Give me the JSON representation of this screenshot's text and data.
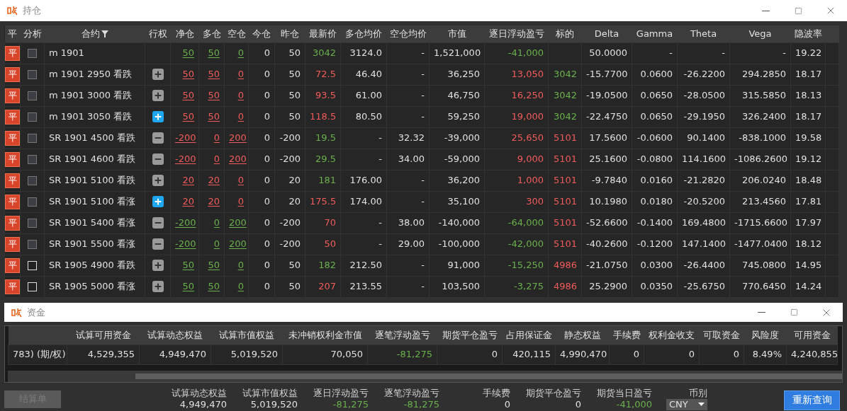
{
  "positions": {
    "title": "持仓",
    "columns": [
      "平",
      "分析",
      "合约",
      "行权",
      "净仓",
      "多仓",
      "空仓",
      "今仓",
      "昨仓",
      "最新价",
      "多仓均价",
      "空仓均价",
      "市值",
      "逐日浮动盈亏",
      "标的",
      "Delta",
      "Gamma",
      "Theta",
      "Vega",
      "隐波率"
    ],
    "rows": [
      {
        "close": "平",
        "checked": false,
        "disabled": true,
        "contract": "m 1901",
        "net": {
          "text": "50",
          "color": "#6ab04c"
        },
        "long": {
          "text": "50",
          "color": "#6ab04c"
        },
        "short": {
          "text": "0",
          "color": "#6ab04c"
        },
        "today": "0",
        "yesterday": "50",
        "last": {
          "text": "3042",
          "color": "#6ab04c"
        },
        "long_avg": "3124.0",
        "short_avg": "-",
        "market_value": "1,521,000",
        "pnl": {
          "text": "-41,000",
          "color": "#6ab04c"
        },
        "delta": "50.0000",
        "gamma": "-",
        "theta": "-",
        "vega": "-",
        "iv": "19.22"
      },
      {
        "close": "平",
        "checked": false,
        "disabled": true,
        "contract": "m 1901 2950 看跌",
        "exercise": {
          "kind": "plus",
          "selected": false
        },
        "net": {
          "text": "50",
          "color": "#f25b5b"
        },
        "long": {
          "text": "50",
          "color": "#f25b5b"
        },
        "short": {
          "text": "0",
          "color": "#f25b5b"
        },
        "today": "0",
        "yesterday": "50",
        "last": {
          "text": "72.5",
          "color": "#f25b5b"
        },
        "long_avg": "46.40",
        "short_avg": "-",
        "market_value": "36,250",
        "pnl": {
          "text": "13,050",
          "color": "#f25b5b"
        },
        "underlying": {
          "text": "3042",
          "color": "#6ab04c"
        },
        "delta": "-15.7700",
        "gamma": "0.0600",
        "theta": "-26.2200",
        "vega": "294.2850",
        "iv": "18.17"
      },
      {
        "close": "平",
        "checked": false,
        "disabled": true,
        "contract": "m 1901 3000 看跌",
        "exercise": {
          "kind": "plus",
          "selected": false
        },
        "net": {
          "text": "50",
          "color": "#f25b5b"
        },
        "long": {
          "text": "50",
          "color": "#f25b5b"
        },
        "short": {
          "text": "0",
          "color": "#f25b5b"
        },
        "today": "0",
        "yesterday": "50",
        "last": {
          "text": "93.5",
          "color": "#f25b5b"
        },
        "long_avg": "61.00",
        "short_avg": "-",
        "market_value": "46,750",
        "pnl": {
          "text": "16,250",
          "color": "#f25b5b"
        },
        "underlying": {
          "text": "3042",
          "color": "#6ab04c"
        },
        "delta": "-19.0500",
        "gamma": "0.0650",
        "theta": "-28.0500",
        "vega": "315.5850",
        "iv": "18.13"
      },
      {
        "close": "平",
        "checked": false,
        "disabled": true,
        "contract": "m 1901 3050 看跌",
        "exercise": {
          "kind": "plus",
          "selected": true
        },
        "net": {
          "text": "50",
          "color": "#f25b5b"
        },
        "long": {
          "text": "50",
          "color": "#f25b5b"
        },
        "short": {
          "text": "0",
          "color": "#f25b5b"
        },
        "today": "0",
        "yesterday": "50",
        "last": {
          "text": "118.5",
          "color": "#f25b5b"
        },
        "long_avg": "80.50",
        "short_avg": "-",
        "market_value": "59,250",
        "pnl": {
          "text": "19,000",
          "color": "#f25b5b"
        },
        "underlying": {
          "text": "3042",
          "color": "#6ab04c"
        },
        "delta": "-22.4750",
        "gamma": "0.0650",
        "theta": "-29.1950",
        "vega": "326.2400",
        "iv": "18.17"
      },
      {
        "close": "平",
        "checked": false,
        "disabled": true,
        "contract": "SR 1901 4500 看跌",
        "exercise": {
          "kind": "minus",
          "selected": false
        },
        "net": {
          "text": "-200",
          "color": "#f25b5b"
        },
        "long": {
          "text": "0",
          "color": "#f25b5b"
        },
        "short": {
          "text": "200",
          "color": "#f25b5b"
        },
        "today": "0",
        "yesterday": "-200",
        "last": {
          "text": "19.5",
          "color": "#6ab04c"
        },
        "long_avg": "-",
        "short_avg": "32.32",
        "market_value": "-39,000",
        "pnl": {
          "text": "25,650",
          "color": "#f25b5b"
        },
        "underlying": {
          "text": "5101",
          "color": "#f25b5b"
        },
        "delta": "17.5600",
        "gamma": "-0.0600",
        "theta": "90.1400",
        "vega": "-838.1000",
        "iv": "19.58"
      },
      {
        "close": "平",
        "checked": false,
        "disabled": true,
        "contract": "SR 1901 4600 看跌",
        "exercise": {
          "kind": "minus",
          "selected": false
        },
        "net": {
          "text": "-200",
          "color": "#f25b5b"
        },
        "long": {
          "text": "0",
          "color": "#f25b5b"
        },
        "short": {
          "text": "200",
          "color": "#f25b5b"
        },
        "today": "0",
        "yesterday": "-200",
        "last": {
          "text": "29.5",
          "color": "#6ab04c"
        },
        "long_avg": "-",
        "short_avg": "34.00",
        "market_value": "-59,000",
        "pnl": {
          "text": "9,000",
          "color": "#f25b5b"
        },
        "underlying": {
          "text": "5101",
          "color": "#f25b5b"
        },
        "delta": "25.1600",
        "gamma": "-0.0800",
        "theta": "114.1600",
        "vega": "-1086.2600",
        "iv": "19.12"
      },
      {
        "close": "平",
        "checked": false,
        "disabled": true,
        "contract": "SR 1901 5100 看跌",
        "exercise": {
          "kind": "plus",
          "selected": false
        },
        "net": {
          "text": "20",
          "color": "#f25b5b"
        },
        "long": {
          "text": "20",
          "color": "#f25b5b"
        },
        "short": {
          "text": "0",
          "color": "#f25b5b"
        },
        "today": "0",
        "yesterday": "20",
        "last": {
          "text": "181",
          "color": "#6ab04c"
        },
        "long_avg": "176.00",
        "short_avg": "-",
        "market_value": "36,200",
        "pnl": {
          "text": "1,000",
          "color": "#f25b5b"
        },
        "underlying": {
          "text": "5101",
          "color": "#f25b5b"
        },
        "delta": "-9.7840",
        "gamma": "0.0160",
        "theta": "-21.2820",
        "vega": "206.0240",
        "iv": "18.48"
      },
      {
        "close": "平",
        "checked": false,
        "disabled": true,
        "contract": "SR 1901 5100 看涨",
        "exercise": {
          "kind": "plus",
          "selected": true
        },
        "net": {
          "text": "20",
          "color": "#f25b5b"
        },
        "long": {
          "text": "20",
          "color": "#f25b5b"
        },
        "short": {
          "text": "0",
          "color": "#f25b5b"
        },
        "today": "0",
        "yesterday": "20",
        "last": {
          "text": "175.5",
          "color": "#f25b5b"
        },
        "long_avg": "174.00",
        "short_avg": "-",
        "market_value": "35,100",
        "pnl": {
          "text": "300",
          "color": "#f25b5b"
        },
        "underlying": {
          "text": "5101",
          "color": "#f25b5b"
        },
        "delta": "10.1980",
        "gamma": "0.0180",
        "theta": "-20.5200",
        "vega": "213.4560",
        "iv": "17.81"
      },
      {
        "close": "平",
        "checked": false,
        "disabled": true,
        "contract": "SR 1901 5400 看涨",
        "exercise": {
          "kind": "minus",
          "selected": false
        },
        "net": {
          "text": "-200",
          "color": "#6ab04c"
        },
        "long": {
          "text": "0",
          "color": "#6ab04c"
        },
        "short": {
          "text": "200",
          "color": "#6ab04c"
        },
        "today": "0",
        "yesterday": "-200",
        "last": {
          "text": "70",
          "color": "#f25b5b"
        },
        "long_avg": "-",
        "short_avg": "38.00",
        "market_value": "-140,000",
        "pnl": {
          "text": "-64,000",
          "color": "#6ab04c"
        },
        "underlying": {
          "text": "5101",
          "color": "#f25b5b"
        },
        "delta": "-52.6600",
        "gamma": "-0.1400",
        "theta": "169.4800",
        "vega": "-1715.6600",
        "iv": "17.97"
      },
      {
        "close": "平",
        "checked": false,
        "disabled": true,
        "contract": "SR 1901 5500 看涨",
        "exercise": {
          "kind": "minus",
          "selected": false
        },
        "net": {
          "text": "-200",
          "color": "#6ab04c"
        },
        "long": {
          "text": "0",
          "color": "#6ab04c"
        },
        "short": {
          "text": "200",
          "color": "#6ab04c"
        },
        "today": "0",
        "yesterday": "-200",
        "last": {
          "text": "50",
          "color": "#f25b5b"
        },
        "long_avg": "-",
        "short_avg": "29.00",
        "market_value": "-100,000",
        "pnl": {
          "text": "-42,000",
          "color": "#6ab04c"
        },
        "underlying": {
          "text": "5101",
          "color": "#f25b5b"
        },
        "delta": "-40.2600",
        "gamma": "-0.1200",
        "theta": "147.1400",
        "vega": "-1477.0400",
        "iv": "18.12"
      },
      {
        "close": "平",
        "checked": false,
        "disabled": false,
        "contract": "SR 1905 4900 看跌",
        "exercise": {
          "kind": "plus",
          "selected": false
        },
        "net": {
          "text": "50",
          "color": "#6ab04c"
        },
        "long": {
          "text": "50",
          "color": "#6ab04c"
        },
        "short": {
          "text": "0",
          "color": "#6ab04c"
        },
        "today": "0",
        "yesterday": "50",
        "last": {
          "text": "182",
          "color": "#6ab04c"
        },
        "long_avg": "212.50",
        "short_avg": "-",
        "market_value": "91,000",
        "pnl": {
          "text": "-15,250",
          "color": "#6ab04c"
        },
        "underlying": {
          "text": "4986",
          "color": "#f25b5b"
        },
        "delta": "-21.0750",
        "gamma": "0.0300",
        "theta": "-26.4400",
        "vega": "745.0800",
        "iv": "14.95"
      },
      {
        "close": "平",
        "checked": false,
        "disabled": false,
        "contract": "SR 1905 5000 看涨",
        "exercise": {
          "kind": "plus",
          "selected": false
        },
        "net": {
          "text": "50",
          "color": "#6ab04c"
        },
        "long": {
          "text": "50",
          "color": "#6ab04c"
        },
        "short": {
          "text": "0",
          "color": "#6ab04c"
        },
        "today": "0",
        "yesterday": "50",
        "last": {
          "text": "207",
          "color": "#f25b5b"
        },
        "long_avg": "213.55",
        "short_avg": "-",
        "market_value": "103,500",
        "pnl": {
          "text": "-3,275",
          "color": "#6ab04c"
        },
        "underlying": {
          "text": "4986",
          "color": "#f25b5b"
        },
        "delta": "25.2900",
        "gamma": "0.0350",
        "theta": "-25.6750",
        "vega": "770.6450",
        "iv": "14.24"
      }
    ]
  },
  "funds": {
    "title": "资金",
    "columns": [
      "试算可用资金",
      "试算动态权益",
      "试算市值权益",
      "未冲销权利金市值",
      "逐笔浮动盈亏",
      "期货平仓盈亏",
      "占用保证金",
      "静态权益",
      "手续费",
      "权利金收支",
      "可取资金",
      "风险度",
      "可用资金"
    ],
    "cells": [
      {
        "text": "783) (期/权)",
        "color": "#e0e0e0"
      },
      {
        "text": "4,529,355",
        "color": "#e0e0e0"
      },
      {
        "text": "4,949,470",
        "color": "#e0e0e0"
      },
      {
        "text": "5,019,520",
        "color": "#e0e0e0"
      },
      {
        "text": "70,050",
        "color": "#e0e0e0"
      },
      {
        "text": "-81,275",
        "color": "#6ab04c"
      },
      {
        "text": "0",
        "color": "#e0e0e0"
      },
      {
        "text": "420,115",
        "color": "#e0e0e0"
      },
      {
        "text": "4,990,470",
        "color": "#e0e0e0"
      },
      {
        "text": "0",
        "color": "#e0e0e0"
      },
      {
        "text": "0",
        "color": "#e0e0e0"
      },
      {
        "text": "0",
        "color": "#e0e0e0"
      },
      {
        "text": "8.49%",
        "color": "#e0e0e0"
      },
      {
        "text": "4,240,855",
        "color": "#e0e0e0"
      }
    ],
    "settle_button": {
      "label": "结算单",
      "disabled": true
    },
    "summary": [
      {
        "label": "试算动态权益",
        "value": "4,949,470",
        "color": "#e0e0e0"
      },
      {
        "label": "试算市值权益",
        "value": "5,019,520",
        "color": "#e0e0e0"
      },
      {
        "label": "逐日浮动盈亏",
        "value": "-81,275",
        "color": "#6ab04c"
      },
      {
        "label": "逐笔浮动盈亏",
        "value": "-81,275",
        "color": "#6ab04c"
      },
      {
        "label": "手续费",
        "value": "0",
        "color": "#e0e0e0"
      },
      {
        "label": "期货平仓盈亏",
        "value": "0",
        "color": "#e0e0e0"
      },
      {
        "label": "期货当日盈亏",
        "value": "-41,000",
        "color": "#6ab04c"
      }
    ],
    "currency": {
      "label": "币别",
      "value": "CNY"
    },
    "requery_button": "重新查询"
  }
}
